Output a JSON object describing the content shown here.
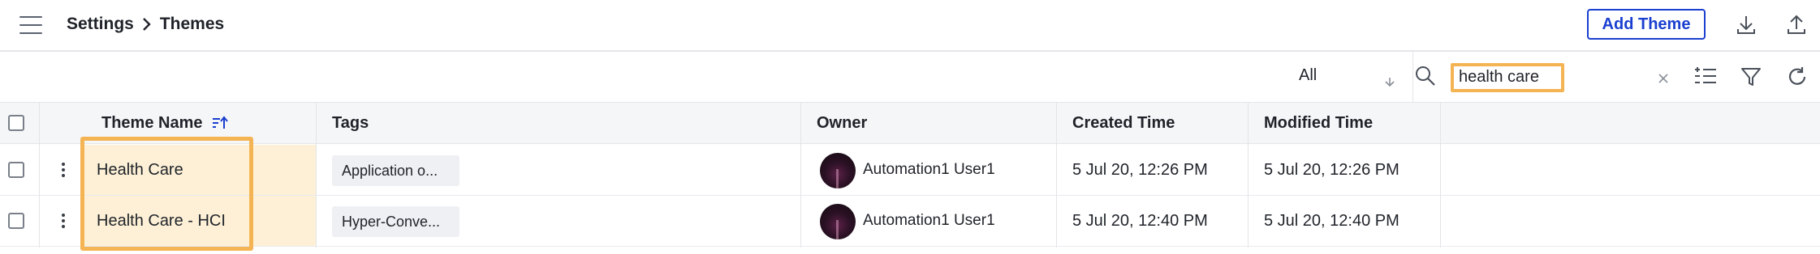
{
  "header": {
    "breadcrumb_root": "Settings",
    "breadcrumb_current": "Themes",
    "add_button_label": "Add Theme",
    "icons": [
      "menu-icon",
      "chevron-right-icon",
      "download-icon",
      "upload-icon"
    ]
  },
  "toolbar": {
    "filter_value": "All",
    "search_value": "health care",
    "icons": [
      "chevron-down-icon",
      "search-icon",
      "close-icon",
      "add-column-icon",
      "filter-icon",
      "refresh-icon"
    ]
  },
  "table": {
    "columns": [
      "Theme Name",
      "Tags",
      "Owner",
      "Created Time",
      "Modified Time"
    ],
    "sort_icon": "sort-ascending-icon",
    "rows": [
      {
        "name": "Health Care",
        "tag": "Application o...",
        "owner": "Automation1 User1",
        "created": "5 Jul 20, 12:26 PM",
        "modified": "5 Jul 20, 12:26 PM"
      },
      {
        "name": "Health Care - HCI",
        "tag": "Hyper-Conve...",
        "owner": "Automation1 User1",
        "created": "5 Jul 20, 12:40 PM",
        "modified": "5 Jul 20, 12:40 PM"
      }
    ]
  },
  "colors": {
    "accent": "#1a3fd0",
    "highlight": "#f5b454",
    "name_cell_bg": "#fdf0d6"
  }
}
